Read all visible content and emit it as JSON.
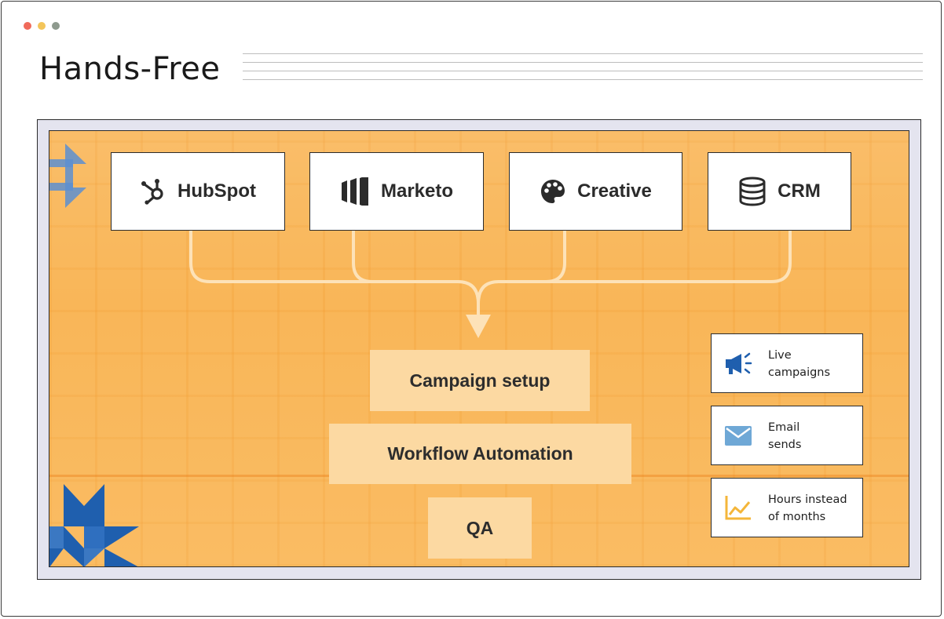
{
  "window": {
    "title": "Hands-Free",
    "controls": [
      "close",
      "minimize",
      "maximize"
    ]
  },
  "tools": [
    {
      "label": "HubSpot",
      "icon": "hubspot-icon"
    },
    {
      "label": "Marketo",
      "icon": "marketo-icon"
    },
    {
      "label": "Creative",
      "icon": "palette-icon"
    },
    {
      "label": "CRM",
      "icon": "database-icon"
    }
  ],
  "steps": [
    {
      "label": "Campaign setup"
    },
    {
      "label": "Workflow Automation"
    },
    {
      "label": "QA"
    }
  ],
  "stats": [
    {
      "line1": "Live",
      "line2": "campaigns",
      "icon": "megaphone-icon"
    },
    {
      "line1": "Email",
      "line2": "sends",
      "icon": "envelope-icon"
    },
    {
      "line1": "Hours instead",
      "line2": "of months",
      "icon": "line-chart-icon"
    }
  ],
  "colors": {
    "panel_background": "#f9b658",
    "step_fill": "#fcd9a2",
    "connector": "#fde2b8",
    "accent_blue": "#1f5fae",
    "envelope_blue": "#6fa8d6",
    "chart_yellow": "#f4b63a"
  }
}
